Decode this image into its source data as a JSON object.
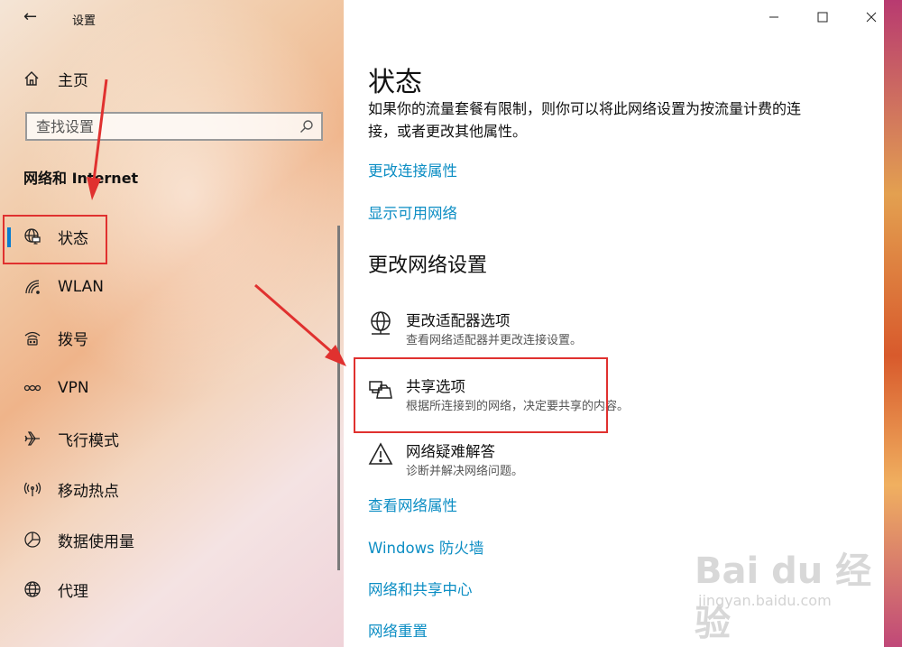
{
  "window": {
    "title": "设置",
    "minimize_label": "minimize",
    "maximize_label": "maximize",
    "close_label": "close"
  },
  "sidebar": {
    "home_label": "主页",
    "search_placeholder": "查找设置",
    "section_title": "网络和 Internet",
    "items": [
      {
        "label": "状态",
        "icon": "globe-monitor-icon",
        "active": true
      },
      {
        "label": "WLAN",
        "icon": "wifi-icon"
      },
      {
        "label": "拨号",
        "icon": "dialup-icon"
      },
      {
        "label": "VPN",
        "icon": "vpn-icon"
      },
      {
        "label": "飞行模式",
        "icon": "airplane-icon"
      },
      {
        "label": "移动热点",
        "icon": "hotspot-icon"
      },
      {
        "label": "数据使用量",
        "icon": "data-usage-icon"
      },
      {
        "label": "代理",
        "icon": "globe-icon"
      }
    ]
  },
  "main": {
    "title": "状态",
    "description": "如果你的流量套餐有限制，则你可以将此网络设置为按流量计费的连接，或者更改其他属性。",
    "links_top": [
      "更改连接属性",
      "显示可用网络"
    ],
    "section_title": "更改网络设置",
    "options": [
      {
        "title": "更改适配器选项",
        "subtitle": "查看网络适配器并更改连接设置。",
        "icon": "adapter-icon"
      },
      {
        "title": "共享选项",
        "subtitle": "根据所连接到的网络，决定要共享的内容。",
        "icon": "sharing-icon"
      },
      {
        "title": "网络疑难解答",
        "subtitle": "诊断并解决网络问题。",
        "icon": "warning-icon"
      }
    ],
    "links_bottom": [
      "查看网络属性",
      "Windows 防火墙",
      "网络和共享中心",
      "网络重置"
    ]
  },
  "watermark": {
    "main": "Bai du 经验",
    "sub": "jingyan.baidu.com"
  },
  "colors": {
    "link": "#0d8ec4",
    "accent": "#0a7ccf",
    "annotation_red": "#e0312f"
  }
}
